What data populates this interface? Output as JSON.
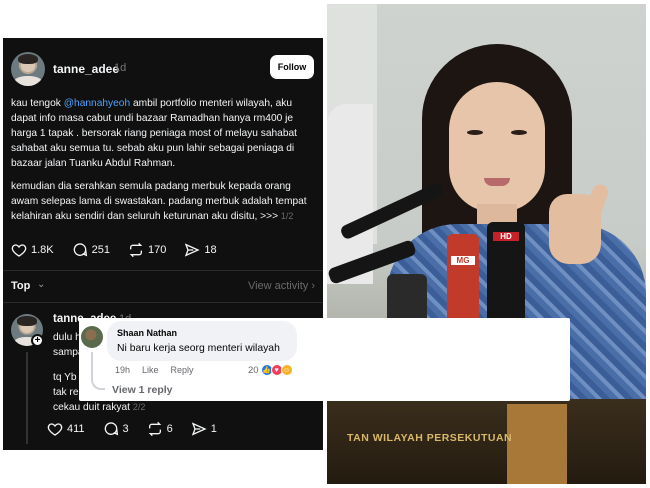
{
  "threads": {
    "post": {
      "username": "tanne_adee",
      "time": "1d",
      "follow_label": "Follow",
      "para1_pre": "kau tengok ",
      "mention": "@hannahyeoh",
      "para1_post": " ambil portfolio menteri wilayah, aku dapat info masa cabut undi bazaar Ramadhan hanya  rm400 je harga 1 tapak . bersorak riang peniaga most of melayu sahabat sahabat aku semua tu. sebab aku pun lahir sebagai peniaga di bazaar jalan Tuanku Abdul Rahman.",
      "para2": "kemudian dia serahkan semula padang merbuk kepada orang awam selepas lama di swastakan. padang merbuk adalah tempat kelahiran aku sendiri dan seluruh keturunan aku disitu, >>>",
      "page_indicator": "1/2",
      "likes": "1.8K",
      "comments": "251",
      "reposts": "170",
      "shares": "18"
    },
    "sort_label": "Top",
    "view_activity": "View activity",
    "reply": {
      "username": "tanne_adee",
      "time": "1d",
      "line1": "dulu ha",
      "line2": "sampai",
      "block_line1": "tq Yb M",
      "block_line2": "tak rem",
      "block_line3": "cekau duit rakyat",
      "page_indicator": "2/2",
      "likes": "411",
      "comments": "3",
      "reposts": "6",
      "shares": "1"
    }
  },
  "facebook_comment": {
    "name": "Shaan Nathan",
    "text": "Ni baru kerja seorg menteri wilayah",
    "time": "19h",
    "like_label": "Like",
    "reply_label": "Reply",
    "reaction_count": "20",
    "view_replies": "View 1 reply",
    "reactions": [
      "like",
      "love",
      "haha"
    ]
  },
  "photo": {
    "podium_text": "TAN WILAYAH PERSEKUTUAN",
    "mic_labels": [
      "HD",
      "MG"
    ]
  },
  "colors": {
    "threads_bg": "#101010",
    "mention": "#4aa3ff",
    "fb_like": "#1877f2",
    "fb_love": "#f33e58",
    "fb_haha": "#f7b125"
  }
}
